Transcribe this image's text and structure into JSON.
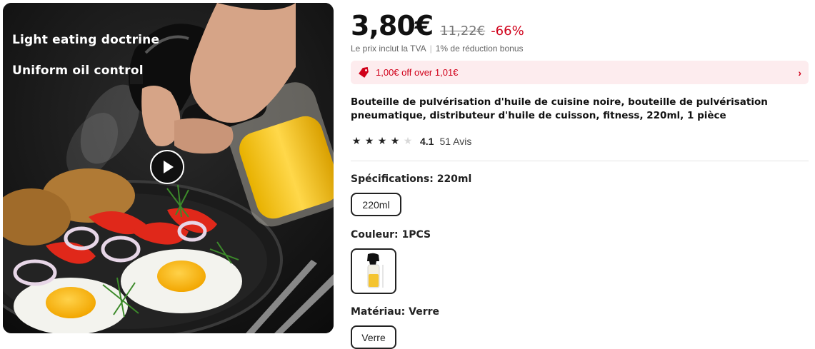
{
  "media": {
    "overlay_line1": "Light eating doctrine",
    "overlay_line2": "Uniform oil control",
    "play_icon": "play-icon"
  },
  "price": {
    "current": "3,80€",
    "original": "11,22€",
    "discount": "-66%"
  },
  "vat": {
    "included": "Le prix inclut la TVA",
    "bonus": "1% de réduction bonus"
  },
  "promo": {
    "text": "1,00€ off over 1,01€",
    "icon": "tag-icon",
    "chevron": "›",
    "color": "#d0021b",
    "background": "#fdecee"
  },
  "product": {
    "title": "Bouteille de pulvérisation d'huile de cuisine noire, bouteille de pulvérisation pneumatique, distributeur d'huile de cuisson, fitness, 220ml, 1 pièce"
  },
  "rating": {
    "value": "4.1",
    "stars_filled": 4,
    "stars_total": 5,
    "reviews": "51 Avis"
  },
  "specs": {
    "size_label": "Spécifications:",
    "size_value": "220ml",
    "size_options": [
      "220ml"
    ],
    "color_label": "Couleur:",
    "color_value": "1PCS",
    "material_label": "Matériau:",
    "material_value": "Verre",
    "material_options": [
      "Verre"
    ]
  }
}
